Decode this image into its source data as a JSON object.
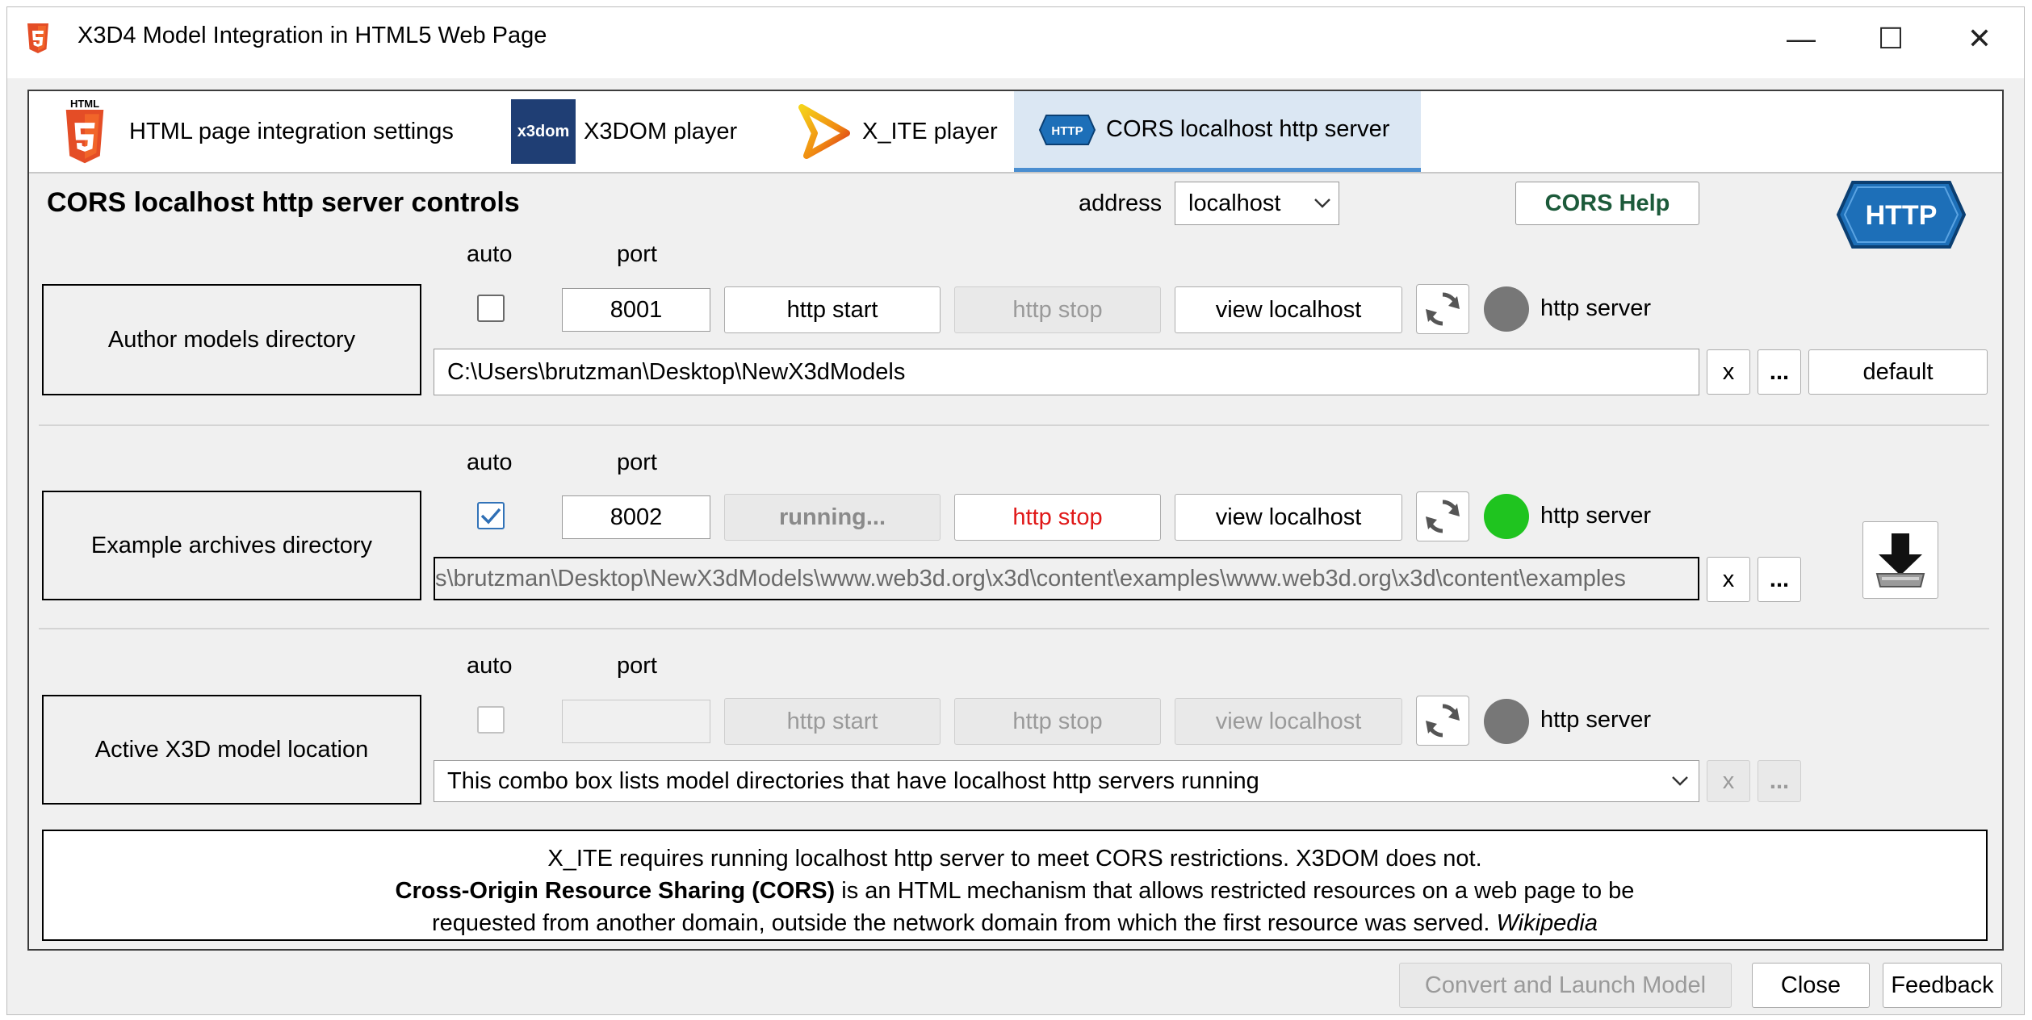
{
  "window": {
    "title": "X3D4 Model Integration in HTML5 Web Page",
    "title_icon": "html5-icon",
    "controls": {
      "minimize": "—",
      "maximize": "☐",
      "close": "✕"
    }
  },
  "tabs": [
    {
      "label": "HTML page integration settings",
      "icon": "html5-icon",
      "icon_text": "HTML",
      "selected": false
    },
    {
      "label": "X3DOM player",
      "icon": "x3dom-icon",
      "icon_text": "x3dom",
      "selected": false
    },
    {
      "label": "X_ITE player",
      "icon": "x-ite-icon",
      "selected": false
    },
    {
      "label": "CORS localhost http server",
      "icon": "http-icon",
      "icon_text": "HTTP",
      "selected": true
    }
  ],
  "header": {
    "title": "CORS localhost http server controls",
    "address_label": "address",
    "address_value": "localhost",
    "cors_help_label": "CORS Help",
    "http_badge": "HTTP"
  },
  "sections": [
    {
      "directory_label": "Author models directory",
      "auto_label": "auto",
      "port_label": "port",
      "auto_checked": false,
      "port_value": "8001",
      "start_label": "http start",
      "stop_label": "http stop",
      "view_label": "view localhost",
      "status_label": "http server",
      "path_value": "C:\\Users\\brutzman\\Desktop\\NewX3dModels",
      "clear_label": "x",
      "browse_label": "...",
      "default_label": "default"
    },
    {
      "directory_label": "Example archives directory",
      "auto_label": "auto",
      "port_label": "port",
      "auto_checked": true,
      "port_value": "8002",
      "start_label": "running...",
      "stop_label": "http stop",
      "view_label": "view localhost",
      "status_label": "http server",
      "path_value": "s\\brutzman\\Desktop\\NewX3dModels\\www.web3d.org\\x3d\\content\\examples\\www.web3d.org\\x3d\\content\\examples",
      "clear_label": "x",
      "browse_label": "...",
      "download_icon": "download-icon"
    },
    {
      "directory_label": "Active X3D model location",
      "auto_label": "auto",
      "port_label": "port",
      "auto_checked": false,
      "port_value": "",
      "start_label": "http start",
      "stop_label": "http stop",
      "view_label": "view localhost",
      "status_label": "http server",
      "combo_value": "This combo box lists model directories that have localhost http servers running",
      "clear_label": "x",
      "browse_label": "..."
    }
  ],
  "info": {
    "line1": "X_ITE requires running localhost http server to meet CORS restrictions. X3DOM does not.",
    "line2_bold": "Cross-Origin Resource Sharing (CORS)",
    "line2_rest": " is an HTML mechanism that allows restricted resources on a web page to be",
    "line3": "requested from another domain, outside the network domain from which the first resource was served.",
    "line3_italic": "Wikipedia"
  },
  "footer": {
    "convert_label": "Convert and Launch Model",
    "close_label": "Close",
    "feedback_label": "Feedback"
  },
  "colors": {
    "running_green": "#1fc41f",
    "stopped_gray": "#777777",
    "stop_red": "#e01818",
    "tab_selected": "#dbe7f3",
    "http_blue": "#1d6fb8",
    "cors_help_green": "#1c5a3a"
  }
}
